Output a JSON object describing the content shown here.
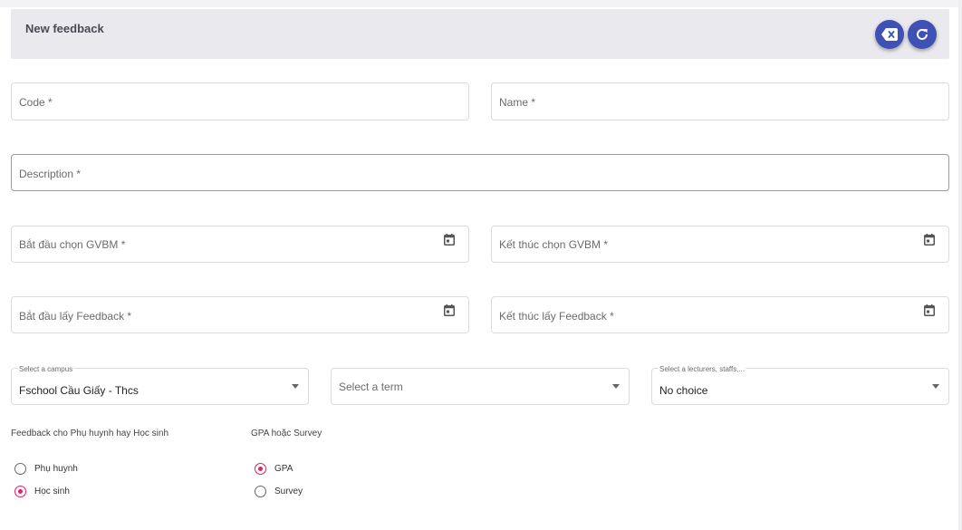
{
  "header": {
    "title": "New feedback",
    "clear_icon": "backspace-clear-icon",
    "refresh_icon": "refresh-icon"
  },
  "form": {
    "code_label": "Code *",
    "name_label": "Name *",
    "description_label": "Description *",
    "start_teacher_label": "Bắt đầu chọn GVBM *",
    "end_teacher_label": "Kết thúc chọn GVBM *",
    "start_feedback_label": "Bắt đầu lấy Feedback *",
    "end_feedback_label": "Kết thúc lấy Feedback *",
    "campus": {
      "label": "Select a campus",
      "value": "Fschool Cầu Giấy - Thcs"
    },
    "term": {
      "placeholder": "Select a term"
    },
    "lecturers": {
      "label": "Select a lecturers, staffs,...",
      "value": "No choice"
    }
  },
  "target_group": {
    "label": "Feedback cho Phụ huynh hay Học sinh",
    "options": [
      {
        "label": "Phụ huynh",
        "selected": false
      },
      {
        "label": "Học sinh",
        "selected": true
      }
    ]
  },
  "type_group": {
    "label": "GPA hoặc Survey",
    "options": [
      {
        "label": "GPA",
        "selected": true
      },
      {
        "label": "Survey",
        "selected": false
      }
    ]
  },
  "colors": {
    "primary": "#3f51b5",
    "accent": "#e91e63",
    "header_bg": "#e9e9ee"
  }
}
